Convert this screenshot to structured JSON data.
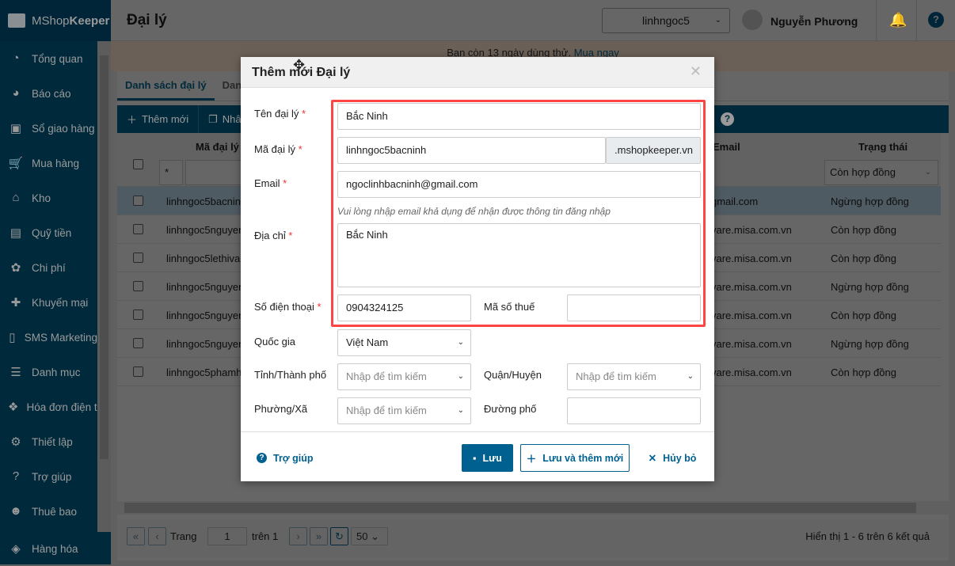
{
  "app": {
    "logo_light": "MShop",
    "logo_bold": "Keeper"
  },
  "sidebar": {
    "items": [
      {
        "label": "Tổng quan",
        "icon": "dashboard-icon",
        "glyph": "◔"
      },
      {
        "label": "Báo cáo",
        "icon": "pie-chart-icon",
        "glyph": "◕"
      },
      {
        "label": "Sổ giao hàng",
        "icon": "truck-icon",
        "glyph": "▣"
      },
      {
        "label": "Mua hàng",
        "icon": "cart-icon",
        "glyph": "🛒"
      },
      {
        "label": "Kho",
        "icon": "warehouse-icon",
        "glyph": "⌂"
      },
      {
        "label": "Quỹ tiền",
        "icon": "safe-icon",
        "glyph": "▤"
      },
      {
        "label": "Chi phí",
        "icon": "expense-icon",
        "glyph": "✿"
      },
      {
        "label": "Khuyến mại",
        "icon": "gift-icon",
        "glyph": "✚"
      },
      {
        "label": "SMS Marketing",
        "icon": "phone-icon",
        "glyph": "▯"
      },
      {
        "label": "Danh mục",
        "icon": "list-icon",
        "glyph": "☰"
      },
      {
        "label": "Hóa đơn điện tử",
        "icon": "invoice-icon",
        "glyph": "❖"
      },
      {
        "label": "Thiết lập",
        "icon": "gear-icon",
        "glyph": "⚙"
      },
      {
        "label": "Trợ giúp",
        "icon": "help-icon",
        "glyph": "?"
      },
      {
        "label": "Thuê bao",
        "icon": "user-icon",
        "glyph": "☻"
      },
      {
        "label": "Hàng hóa",
        "icon": "goods-icon",
        "glyph": "◈"
      }
    ]
  },
  "header": {
    "title": "Đại lý",
    "store": "linhngoc5",
    "user": "Nguyễn Phương"
  },
  "banner": {
    "text": "Bạn còn 13 ngày dùng thử.",
    "link": "Mua ngay"
  },
  "tabs": [
    "Danh sách đại lý",
    "Danh"
  ],
  "toolbar": {
    "add": "Thêm mới",
    "copy": "Nhân"
  },
  "table": {
    "headers": {
      "code": "Mã đại lý",
      "email": "Email",
      "status": "Trạng thái"
    },
    "filter_code_op": "*",
    "filter_status": "Còn hợp đồng",
    "rows": [
      {
        "code": "linhngoc5bacnin",
        "email": "gmail.com",
        "status": "Ngừng hợp đồng"
      },
      {
        "code": "linhngoc5nguyen",
        "email": "vare.misa.com.vn",
        "status": "Còn hợp đồng"
      },
      {
        "code": "linhngoc5lethiva",
        "email": "vare.misa.com.vn",
        "status": "Còn hợp đồng"
      },
      {
        "code": "linhngoc5nguyen",
        "email": "vare.misa.com.vn",
        "status": "Ngừng hợp đồng"
      },
      {
        "code": "linhngoc5nguyen",
        "email": "vare.misa.com.vn",
        "status": "Còn hợp đồng"
      },
      {
        "code": "linhngoc5nguyen",
        "email": "vare.misa.com.vn",
        "status": "Ngừng hợp đồng"
      },
      {
        "code": "linhngoc5phamh",
        "email": "vare.misa.com.vn",
        "status": "Còn hợp đồng"
      }
    ]
  },
  "pager": {
    "page_label": "Trang",
    "page": "1",
    "of": "trên 1",
    "page_size": "50",
    "summary": "Hiển thị 1 - 6 trên 6 kết quả"
  },
  "modal": {
    "title": "Thêm mới Đại lý",
    "name_label": "Tên đại lý",
    "name_value": "Bắc Ninh",
    "code_label": "Mã đại lý",
    "code_value": "linhngoc5bacninh",
    "code_suffix": ".mshopkeeper.vn",
    "email_label": "Email",
    "email_value": "ngoclinhbacninh@gmail.com",
    "email_hint": "Vui lòng nhập email khả dụng để nhận được thông tin đăng nhập",
    "address_label": "Địa chỉ",
    "address_value": "Bắc Ninh",
    "phone_label": "Số điện thoại",
    "phone_value": "0904324125",
    "tax_label": "Mã số thuế",
    "tax_value": "",
    "country_label": "Quốc gia",
    "country_value": "Việt Nam",
    "province_label": "Tỉnh/Thành phố",
    "district_label": "Quận/Huyện",
    "ward_label": "Phường/Xã",
    "street_label": "Đường phố",
    "search_placeholder": "Nhập để tìm kiếm",
    "required_mark": "*",
    "help": "Trợ giúp",
    "save": "Lưu",
    "save_new": "Lưu và thêm mới",
    "cancel": "Hủy bỏ"
  }
}
